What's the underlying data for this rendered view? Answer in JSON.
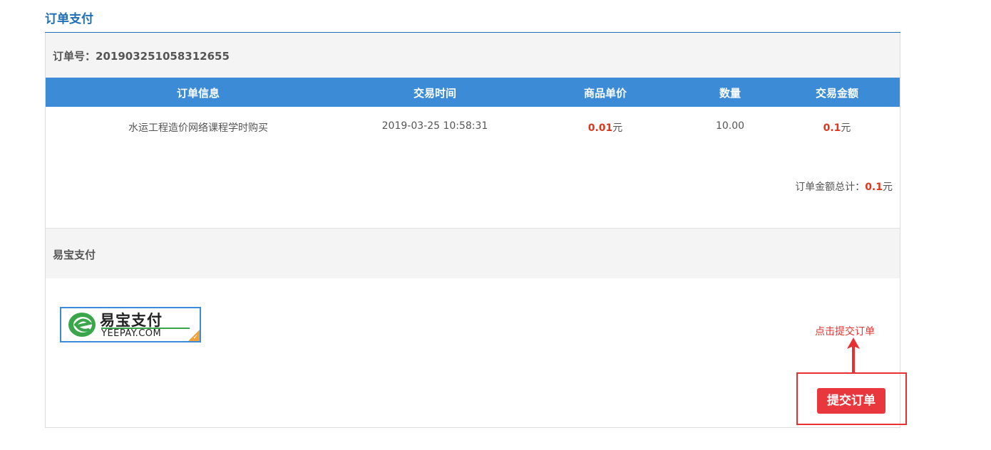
{
  "page": {
    "title": "订单支付"
  },
  "order": {
    "number_label": "订单号：",
    "number": "201903251058312655"
  },
  "table": {
    "headers": [
      "订单信息",
      "交易时间",
      "商品单价",
      "数量",
      "交易金额"
    ],
    "rows": [
      {
        "info": "水运工程造价网络课程学时购买",
        "time": "2019-03-25 10:58:31",
        "unit_price": "0.01",
        "unit_price_suffix": "元",
        "quantity": "10.00",
        "amount": "0.1",
        "amount_suffix": "元"
      }
    ]
  },
  "total": {
    "label": "订单金额总计：",
    "value": "0.1",
    "suffix": "元"
  },
  "payment": {
    "section_title": "易宝支付",
    "logo_text_cn": "易宝支付",
    "logo_text_en": "YEEPAY.COM"
  },
  "annotation": {
    "text": "点击提交订单"
  },
  "actions": {
    "submit_label": "提交订单"
  },
  "colors": {
    "accent_blue": "#3b8bd6",
    "title_blue": "#1f6fb5",
    "price_red": "#e0361d",
    "button_red": "#e8383d",
    "annotation_red": "#e83030"
  }
}
